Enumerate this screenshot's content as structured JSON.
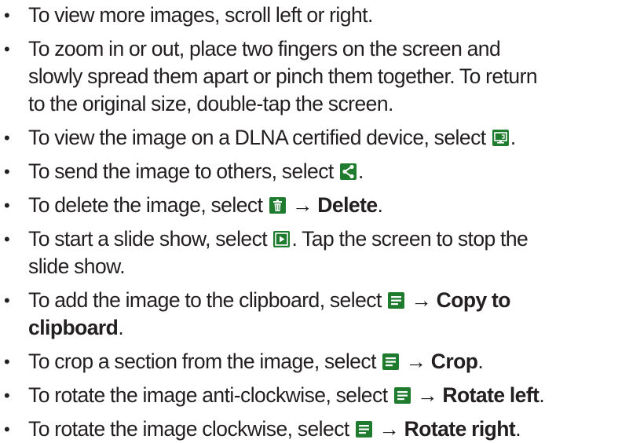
{
  "items": [
    {
      "text": "To view more images, scroll left or right."
    },
    {
      "lines": [
        "To zoom in or out, place two fingers on the screen and",
        "slowly spread them apart or pinch them together. To return",
        "to the original size, double-tap the screen."
      ]
    },
    {
      "pre": "To view the image on a DLNA certified device, select ",
      "icon": "dlna-icon",
      "post": "."
    },
    {
      "pre": "To send the image to others, select ",
      "icon": "share-icon",
      "post": "."
    },
    {
      "pre": "To delete the image, select ",
      "icon": "delete-icon",
      "arrow": " → ",
      "bold": "Delete",
      "post": "."
    },
    {
      "pre": "To start a slide show, select ",
      "icon": "slideshow-icon",
      "post": ". Tap the screen to stop the",
      "line2": "slide show."
    },
    {
      "pre": "To add the image to the clipboard, select ",
      "icon": "menu-icon",
      "arrow": " → ",
      "bold": "Copy to",
      "bold2": "clipboard",
      "post2": "."
    },
    {
      "pre": "To crop a section from the image, select ",
      "icon": "menu-icon",
      "arrow": " → ",
      "bold": "Crop",
      "post": "."
    },
    {
      "pre": "To rotate the image anti-clockwise, select ",
      "icon": "menu-icon",
      "arrow": " → ",
      "bold": "Rotate left",
      "post": "."
    },
    {
      "pre": "To rotate the image clockwise, select ",
      "icon": "menu-icon",
      "arrow": " → ",
      "bold": "Rotate right",
      "post": "."
    }
  ],
  "bullet_char": "•",
  "icon_color": "#1f7b2d"
}
